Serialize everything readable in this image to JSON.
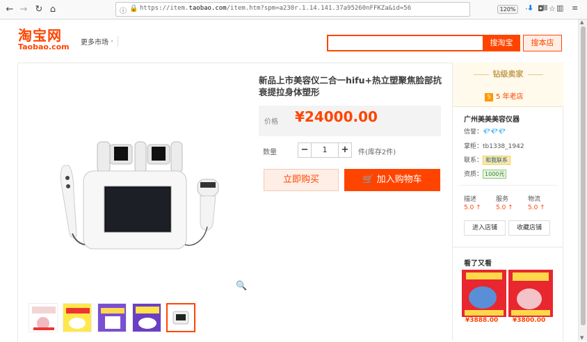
{
  "browser": {
    "url_prefix": "https://item.",
    "url_domain": "taobao.com",
    "url_rest": "/item.htm?spm=a230r.1.14.141.37a95260nFFKZa&id=56",
    "zoom": "120%"
  },
  "header": {
    "logo_cn": "淘宝网",
    "logo_en": "Taobao.com",
    "more_market": "更多市场",
    "search_button": "搜淘宝",
    "search_store_button": "搜本店"
  },
  "product": {
    "title": "新品上市美容仪二合一hifu+热立塑聚焦脸部抗衰提拉身体塑形",
    "price_label": "价格",
    "price": "¥24000.00",
    "qty_label": "数量",
    "qty_value": "1",
    "qty_minus": "−",
    "qty_plus": "+",
    "stock": "件(库存2件)",
    "buy_now": "立即购买",
    "add_to_cart": "加入购物车"
  },
  "shop": {
    "seller_level": "钻级卖家",
    "store_age_badge": "5",
    "store_age": "5 年老店",
    "store_name": "广州美美美容仪器",
    "credit_label": "信誉：",
    "credit_diamonds": "💎💎💎",
    "seller_label": "掌柜：",
    "seller_name": "tb1338_1942",
    "contact_label": "联系：",
    "contact_chip": "和我联系",
    "qualification_label": "资质：",
    "qualification_chip": "1000元",
    "scores": [
      {
        "label": "描述",
        "value": "5.0 ↑"
      },
      {
        "label": "服务",
        "value": "5.0 ↑"
      },
      {
        "label": "物流",
        "value": "5.0 ↑"
      }
    ],
    "enter_store": "进入店铺",
    "favorite_store": "收藏店铺",
    "see_again_title": "看了又看",
    "recommendations": [
      {
        "price": "¥3888.00"
      },
      {
        "price": "¥3800.00"
      }
    ]
  },
  "colors": {
    "accent": "#ff4400",
    "seller_gold": "#c59e56"
  }
}
